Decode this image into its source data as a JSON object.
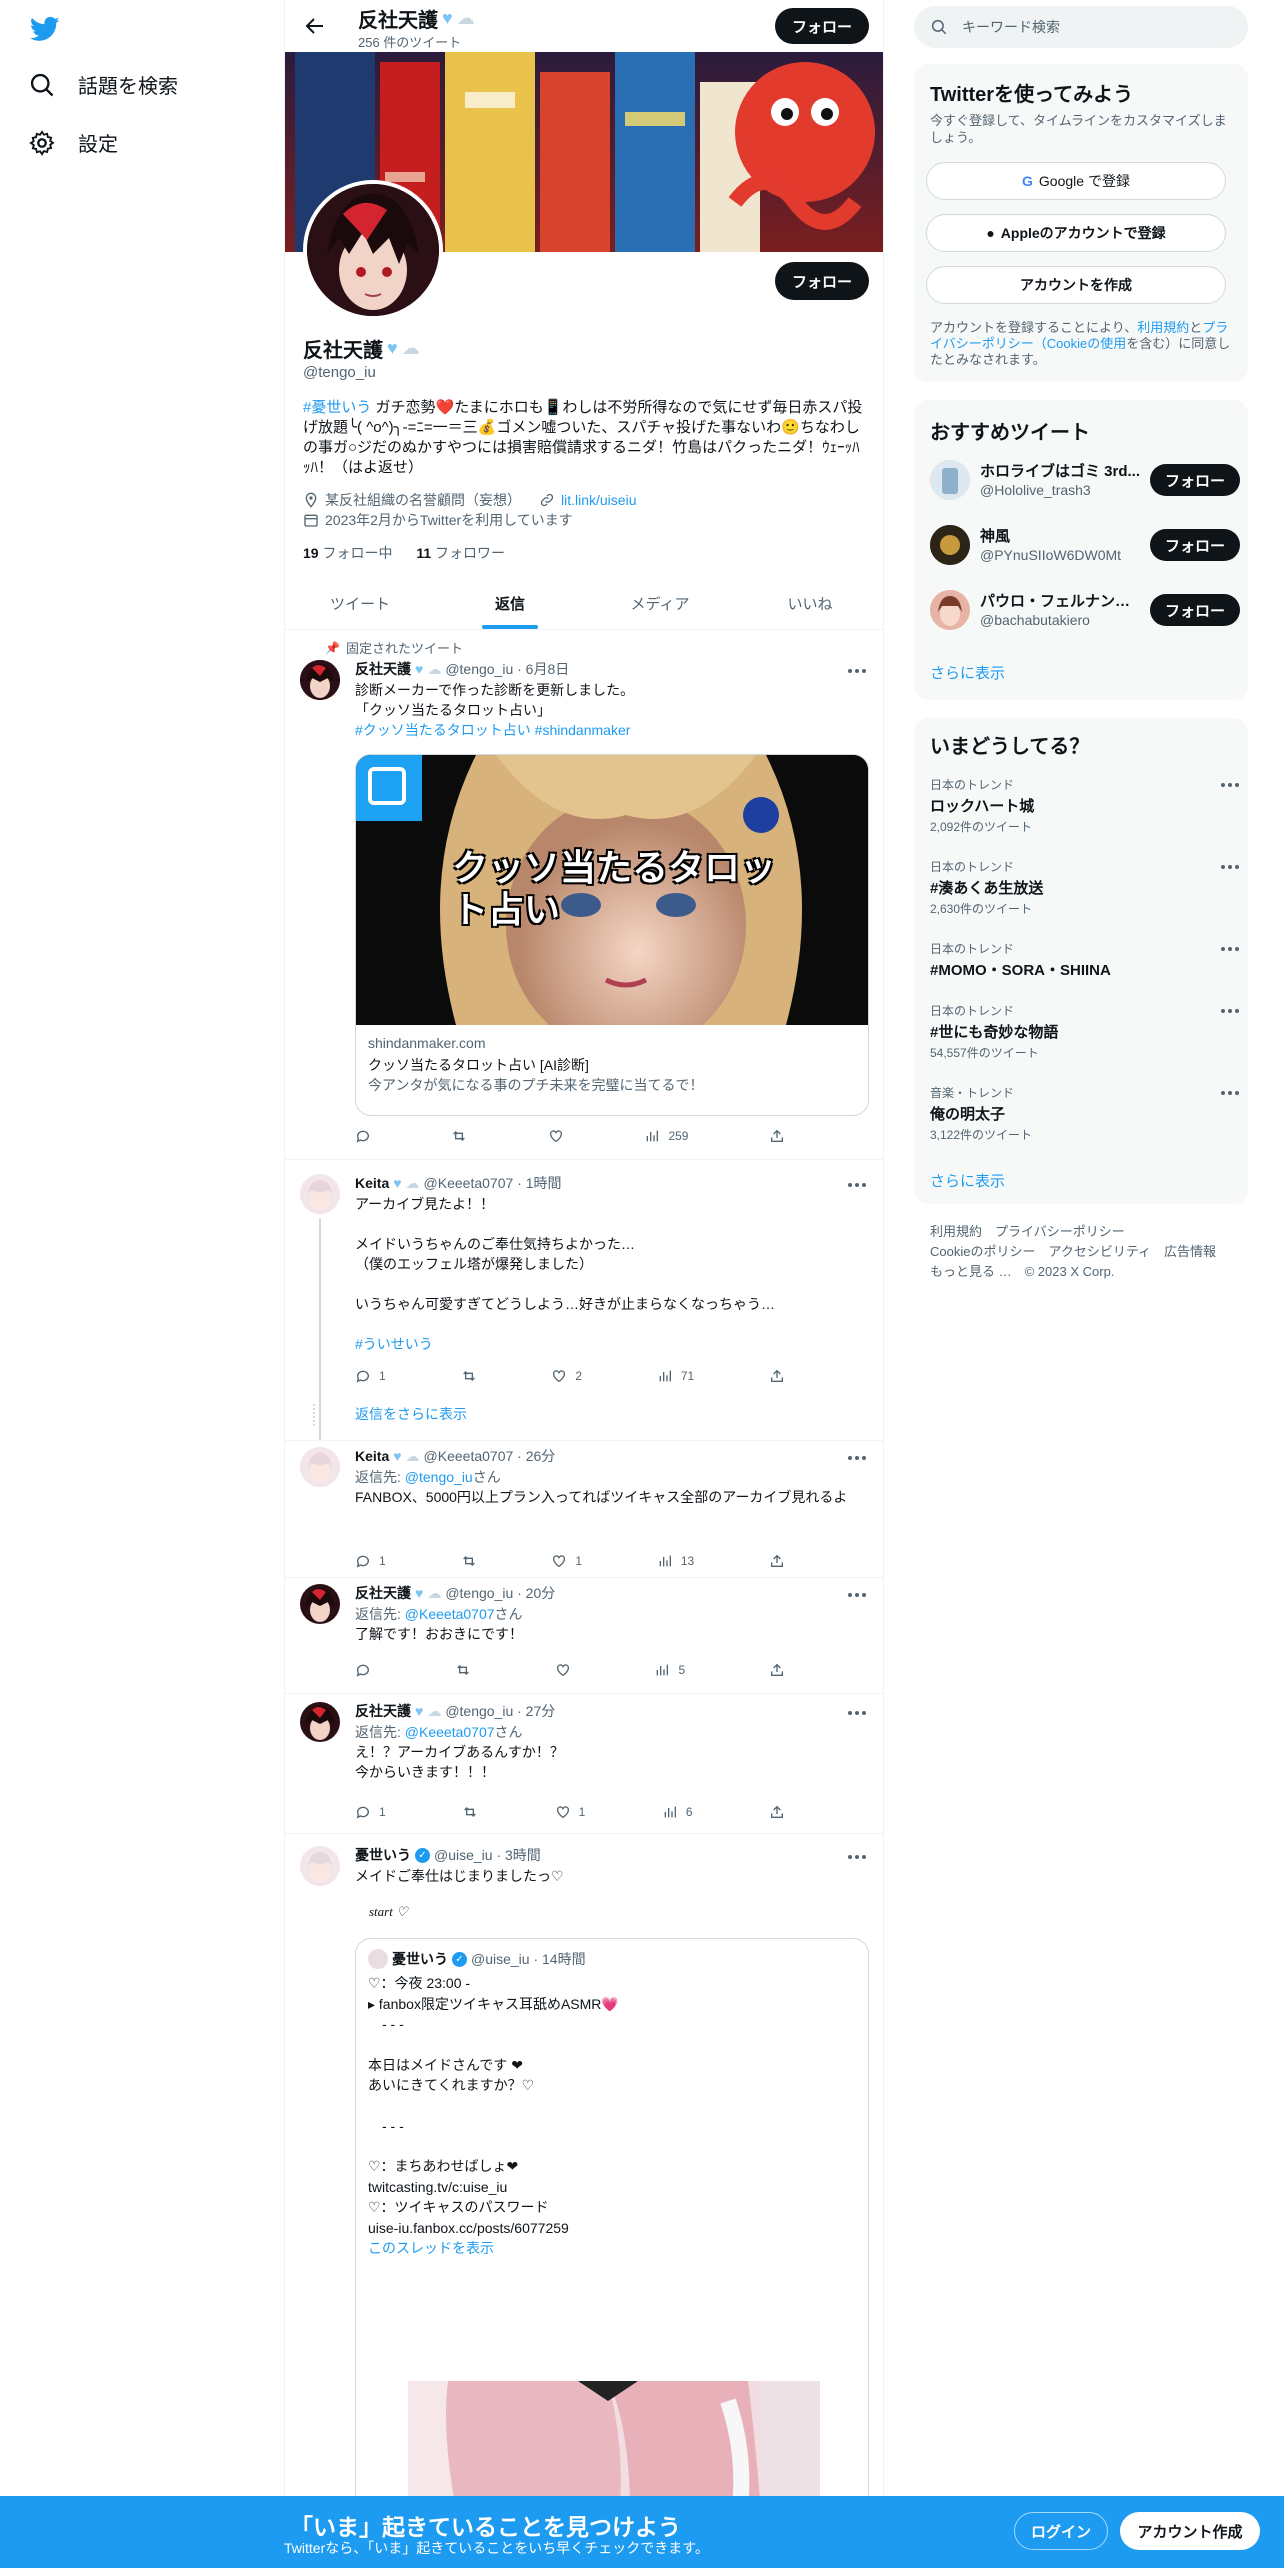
{
  "nav": {
    "explore": "話題を検索",
    "settings": "設定"
  },
  "header": {
    "name": "反社天護",
    "tweet_count": "256 件のツイート",
    "follow": "フォロー"
  },
  "profile": {
    "name": "反社天護",
    "handle": "@tengo_iu",
    "follow": "フォロー",
    "bio_tag": "#憂世いう",
    "bio_text": " ガチ恋勢❤️たまにホロも📱わしは不労所得なので気にせず毎日赤スパ投げ放題╰( ^o^)╮-=ﾆ=一＝三💰ゴメン嘘ついた、スパチャ投げた事ないわ🙂ちなわしの事ガ○ジだのぬかすやつには損害賠償請求するニダ！竹島はパクったニダ！ｳｪｰｯﾊｯﾊ！（はよ返せ）",
    "location": "某反社組織の名誉顧問（妄想）",
    "link": "lit.link/uiseiu",
    "joined": "2023年2月からTwitterを利用しています",
    "following_count": "19",
    "following_label": " フォロー中",
    "followers_count": "11",
    "followers_label": " フォロワー"
  },
  "tabs": [
    "ツイート",
    "返信",
    "メディア",
    "いいね"
  ],
  "pinned": {
    "label": "固定されたツイート",
    "name": "反社天護",
    "handle": "@tengo_iu · 6月8日",
    "line1": "診断メーカーで作った診断を更新しました。",
    "line2": "「クッソ当たるタロット占い」",
    "tags": "#クッソ当たるタロット占い #shindanmaker",
    "card_title_overlay": "クッソ当たるタロット占い",
    "card_domain": "shindanmaker.com",
    "card_title": "クッソ当たるタロット占い [AI診断]",
    "card_desc": "今アンタが気になる事のプチ未来を完璧に当てるで！",
    "views": "259"
  },
  "t1": {
    "name": "Keita",
    "handle": "@Keeeta0707 · 1時間",
    "l1": "アーカイブ見たよ！！",
    "l2": "メイドいうちゃんのご奉仕気持ちよかった…",
    "l3": "（僕のエッフェル塔が爆発しました）",
    "l4": "いうちゃん可愛すぎてどうしよう…好きが止まらなくなっちゃう…",
    "tag": "#ういせいう",
    "replies": "1",
    "likes": "2",
    "views": "71",
    "show_more": "返信をさらに表示"
  },
  "t2": {
    "name": "Keita",
    "handle": "@Keeeta0707 · 26分",
    "reply_prefix": "返信先: ",
    "reply_to": "@tengo_iu",
    "reply_suffix": "さん",
    "text": "FANBOX、5000円以上プラン入ってればツイキャス全部のアーカイブ見れるよ",
    "replies": "1",
    "likes": "1",
    "views": "13"
  },
  "t3": {
    "name": "反社天護",
    "handle": "@tengo_iu · 20分",
    "reply_prefix": "返信先: ",
    "reply_to": "@Keeeta0707",
    "reply_suffix": "さん",
    "text": "了解です！おおきにです！",
    "views": "5"
  },
  "t4": {
    "name": "反社天護",
    "handle": "@tengo_iu · 27分",
    "reply_prefix": "返信先: ",
    "reply_to": "@Keeeta0707",
    "reply_suffix": "さん",
    "l1": "え！？アーカイブあるんすか！？",
    "l2": "今からいきます！！！",
    "replies": "1",
    "likes": "1",
    "views": "6"
  },
  "t5": {
    "name": "憂世いう",
    "handle": "@uise_iu · 3時間",
    "text": "メイドご奉仕はじまりましたっ♡",
    "start": "start ♡",
    "q_name": "憂世いう",
    "q_handle": "@uise_iu · 14時間",
    "q_l1": "♡：今夜 23:00 -",
    "q_l2": "▸ fanbox限定ツイキャス耳舐めASMR💗",
    "q_l3": "- - -",
    "q_l4": "本日はメイドさんです ❤",
    "q_l5": "あいにきてくれますか？♡",
    "q_l6": "- - -",
    "q_l7": "♡：まちあわせばしょ❤",
    "q_l8": "twitcasting.tv/c:uise_iu",
    "q_l9": "♡：ツイキャスのパスワード",
    "q_l10": "uise-iu.fanbox.cc/posts/6077259",
    "q_thread": "このスレッドを表示"
  },
  "right": {
    "search_placeholder": "キーワード検索",
    "signup_title": "Twitterを使ってみよう",
    "signup_sub": "今すぐ登録して、タイムラインをカスタマイズしましょう。",
    "google": "Google で登録",
    "apple": "Appleのアカウントで登録",
    "create": "アカウントを作成",
    "terms_pre": "アカウントを登録することにより、",
    "terms_link1": "利用規約",
    "terms_mid": "と",
    "terms_link2": "プライバシーポリシー（Cookieの使用",
    "terms_post": "を含む）に同意したとみなされます。",
    "rec_title": "おすすめツイート",
    "recs": [
      {
        "name": "ホロライブはゴミ 3rd...",
        "handle": "@Hololive_trash3",
        "follow": "フォロー"
      },
      {
        "name": "神風",
        "handle": "@PYnuSIIoW6DW0Mt",
        "follow": "フォロー"
      },
      {
        "name": "パウロ・フェルナンデ...",
        "handle": "@bachabutakiero",
        "follow": "フォロー"
      }
    ],
    "show_more": "さらに表示",
    "trends_title": "いまどうしてる？",
    "trends": [
      {
        "cat": "日本のトレンド",
        "title": "ロックハート城",
        "count": "2,092件のツイート"
      },
      {
        "cat": "日本のトレンド",
        "title": "#湊あくあ生放送",
        "count": "2,630件のツイート"
      },
      {
        "cat": "日本のトレンド",
        "title": "#MOMO・SORA・SHIINA",
        "count": ""
      },
      {
        "cat": "日本のトレンド",
        "title": "#世にも奇妙な物語",
        "count": "54,557件のツイート"
      },
      {
        "cat": "音楽・トレンド",
        "title": "俺の明太子",
        "count": "3,122件のツイート"
      }
    ],
    "trends_more": "さらに表示",
    "footer1": "利用規約　プライバシーポリシー",
    "footer2": "Cookieのポリシー　アクセシビリティ　広告情報",
    "footer3": "もっと見る …　© 2023 X Corp."
  },
  "bottom": {
    "title": "「いま」起きていることを見つけよう",
    "sub": "Twitterなら、「いま」起きていることをいち早くチェックできます。",
    "login": "ログイン",
    "signup": "アカウント作成"
  }
}
